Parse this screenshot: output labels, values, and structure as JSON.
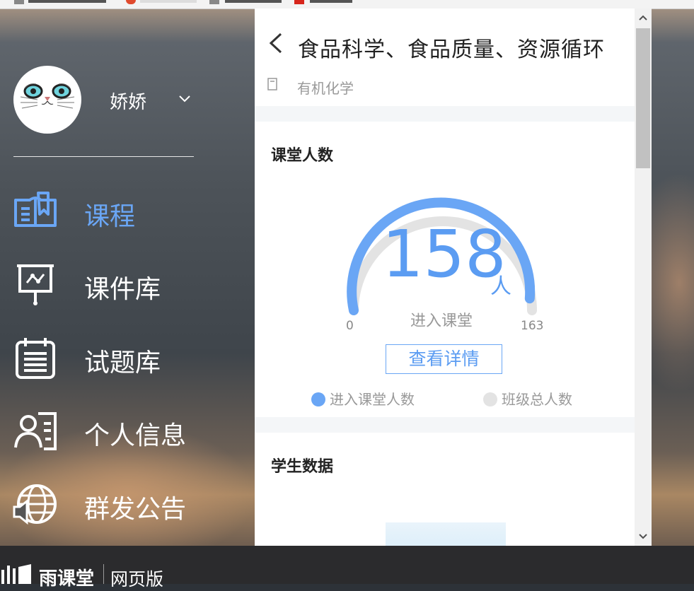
{
  "user": {
    "name": "娇娇"
  },
  "nav": {
    "items": [
      {
        "label": "课程",
        "icon": "book-icon",
        "active": true
      },
      {
        "label": "课件库",
        "icon": "presentation-icon",
        "active": false
      },
      {
        "label": "试题库",
        "icon": "notepad-icon",
        "active": false
      },
      {
        "label": "个人信息",
        "icon": "profile-icon",
        "active": false
      },
      {
        "label": "群发公告",
        "icon": "globe-broadcast-icon",
        "active": false
      }
    ]
  },
  "course": {
    "title": "食品科学、食品质量、资源循环",
    "subject": "有机化学"
  },
  "attendance": {
    "section_title": "课堂人数",
    "count": "158",
    "unit": "人",
    "caption": "进入课堂",
    "min_label": "0",
    "max_label": "163",
    "entered": 158,
    "total": 163,
    "detail_button": "查看详情",
    "legend": [
      {
        "label": "进入课堂人数",
        "color": "#6aa6f5"
      },
      {
        "label": "班级总人数",
        "color": "#e3e3e3"
      }
    ]
  },
  "student_data": {
    "section_title": "学生数据"
  },
  "footer": {
    "brand": "雨课堂",
    "sub": "网页版"
  },
  "colors": {
    "accent": "#6aa6f5",
    "gauge_track": "#e3e3e3"
  }
}
